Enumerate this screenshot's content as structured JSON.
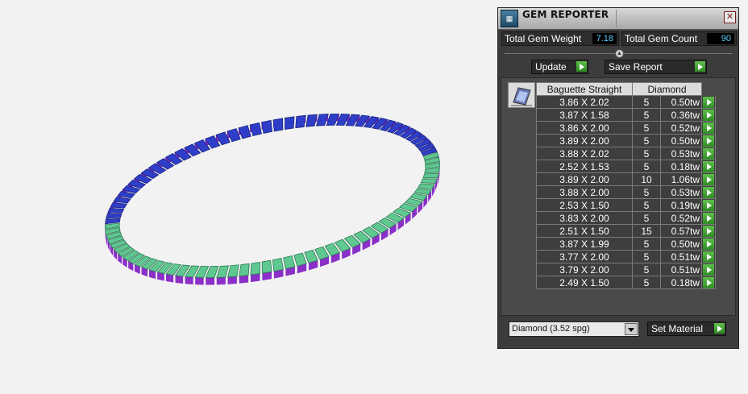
{
  "panel": {
    "title": "GEM REPORTER",
    "app_icon": "gem-report-icon",
    "close_label": "✕",
    "total_weight_label": "Total Gem Weight",
    "total_weight_value": "7.18",
    "total_count_label": "Total Gem Count",
    "total_count_value": "90",
    "update_label": "Update",
    "save_report_label": "Save Report",
    "set_material_label": "Set Material",
    "material_value": "Diamond    (3.52 spg)"
  },
  "table": {
    "shape_header": "Baguette Straight",
    "material_header": "Diamond",
    "rows": [
      {
        "size": "3.86 X 2.02",
        "count": "5",
        "weight": "0.50tw"
      },
      {
        "size": "3.87 X 1.58",
        "count": "5",
        "weight": "0.36tw"
      },
      {
        "size": "3.86 X 2.00",
        "count": "5",
        "weight": "0.52tw"
      },
      {
        "size": "3.89 X 2.00",
        "count": "5",
        "weight": "0.50tw"
      },
      {
        "size": "3.88 X 2.02",
        "count": "5",
        "weight": "0.53tw"
      },
      {
        "size": "2.52 X 1.53",
        "count": "5",
        "weight": "0.18tw"
      },
      {
        "size": "3.89 X 2.00",
        "count": "10",
        "weight": "1.06tw"
      },
      {
        "size": "3.88 X 2.00",
        "count": "5",
        "weight": "0.53tw"
      },
      {
        "size": "2.53 X 1.50",
        "count": "5",
        "weight": "0.19tw"
      },
      {
        "size": "3.83 X 2.00",
        "count": "5",
        "weight": "0.52tw"
      },
      {
        "size": "2.51 X 1.50",
        "count": "15",
        "weight": "0.57tw"
      },
      {
        "size": "3.87 X 1.99",
        "count": "5",
        "weight": "0.50tw"
      },
      {
        "size": "3.77 X 2.00",
        "count": "5",
        "weight": "0.51tw"
      },
      {
        "size": "3.79 X 2.00",
        "count": "5",
        "weight": "0.51tw"
      },
      {
        "size": "2.49 X 1.50",
        "count": "5",
        "weight": "0.18tw"
      }
    ]
  },
  "colors": {
    "stone_blue": "#2f3ec8",
    "setting_purple": "#8a2fc8",
    "metal_green": "#5fc890",
    "accent_green": "#3fa02e",
    "value_cyan": "#5fd0ff"
  }
}
